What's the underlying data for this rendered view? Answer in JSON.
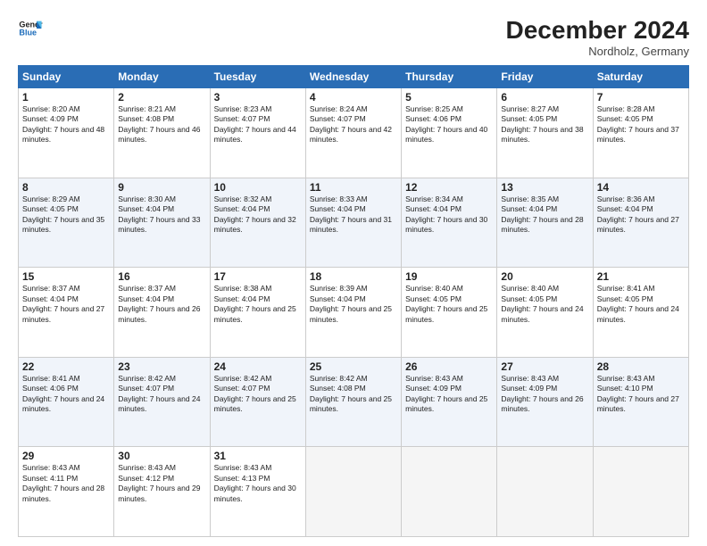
{
  "logo": {
    "line1": "General",
    "line2": "Blue"
  },
  "title": "December 2024",
  "location": "Nordholz, Germany",
  "days_header": [
    "Sunday",
    "Monday",
    "Tuesday",
    "Wednesday",
    "Thursday",
    "Friday",
    "Saturday"
  ],
  "weeks": [
    [
      {
        "day": "1",
        "sunrise": "Sunrise: 8:20 AM",
        "sunset": "Sunset: 4:09 PM",
        "daylight": "Daylight: 7 hours and 48 minutes."
      },
      {
        "day": "2",
        "sunrise": "Sunrise: 8:21 AM",
        "sunset": "Sunset: 4:08 PM",
        "daylight": "Daylight: 7 hours and 46 minutes."
      },
      {
        "day": "3",
        "sunrise": "Sunrise: 8:23 AM",
        "sunset": "Sunset: 4:07 PM",
        "daylight": "Daylight: 7 hours and 44 minutes."
      },
      {
        "day": "4",
        "sunrise": "Sunrise: 8:24 AM",
        "sunset": "Sunset: 4:07 PM",
        "daylight": "Daylight: 7 hours and 42 minutes."
      },
      {
        "day": "5",
        "sunrise": "Sunrise: 8:25 AM",
        "sunset": "Sunset: 4:06 PM",
        "daylight": "Daylight: 7 hours and 40 minutes."
      },
      {
        "day": "6",
        "sunrise": "Sunrise: 8:27 AM",
        "sunset": "Sunset: 4:05 PM",
        "daylight": "Daylight: 7 hours and 38 minutes."
      },
      {
        "day": "7",
        "sunrise": "Sunrise: 8:28 AM",
        "sunset": "Sunset: 4:05 PM",
        "daylight": "Daylight: 7 hours and 37 minutes."
      }
    ],
    [
      {
        "day": "8",
        "sunrise": "Sunrise: 8:29 AM",
        "sunset": "Sunset: 4:05 PM",
        "daylight": "Daylight: 7 hours and 35 minutes."
      },
      {
        "day": "9",
        "sunrise": "Sunrise: 8:30 AM",
        "sunset": "Sunset: 4:04 PM",
        "daylight": "Daylight: 7 hours and 33 minutes."
      },
      {
        "day": "10",
        "sunrise": "Sunrise: 8:32 AM",
        "sunset": "Sunset: 4:04 PM",
        "daylight": "Daylight: 7 hours and 32 minutes."
      },
      {
        "day": "11",
        "sunrise": "Sunrise: 8:33 AM",
        "sunset": "Sunset: 4:04 PM",
        "daylight": "Daylight: 7 hours and 31 minutes."
      },
      {
        "day": "12",
        "sunrise": "Sunrise: 8:34 AM",
        "sunset": "Sunset: 4:04 PM",
        "daylight": "Daylight: 7 hours and 30 minutes."
      },
      {
        "day": "13",
        "sunrise": "Sunrise: 8:35 AM",
        "sunset": "Sunset: 4:04 PM",
        "daylight": "Daylight: 7 hours and 28 minutes."
      },
      {
        "day": "14",
        "sunrise": "Sunrise: 8:36 AM",
        "sunset": "Sunset: 4:04 PM",
        "daylight": "Daylight: 7 hours and 27 minutes."
      }
    ],
    [
      {
        "day": "15",
        "sunrise": "Sunrise: 8:37 AM",
        "sunset": "Sunset: 4:04 PM",
        "daylight": "Daylight: 7 hours and 27 minutes."
      },
      {
        "day": "16",
        "sunrise": "Sunrise: 8:37 AM",
        "sunset": "Sunset: 4:04 PM",
        "daylight": "Daylight: 7 hours and 26 minutes."
      },
      {
        "day": "17",
        "sunrise": "Sunrise: 8:38 AM",
        "sunset": "Sunset: 4:04 PM",
        "daylight": "Daylight: 7 hours and 25 minutes."
      },
      {
        "day": "18",
        "sunrise": "Sunrise: 8:39 AM",
        "sunset": "Sunset: 4:04 PM",
        "daylight": "Daylight: 7 hours and 25 minutes."
      },
      {
        "day": "19",
        "sunrise": "Sunrise: 8:40 AM",
        "sunset": "Sunset: 4:05 PM",
        "daylight": "Daylight: 7 hours and 25 minutes."
      },
      {
        "day": "20",
        "sunrise": "Sunrise: 8:40 AM",
        "sunset": "Sunset: 4:05 PM",
        "daylight": "Daylight: 7 hours and 24 minutes."
      },
      {
        "day": "21",
        "sunrise": "Sunrise: 8:41 AM",
        "sunset": "Sunset: 4:05 PM",
        "daylight": "Daylight: 7 hours and 24 minutes."
      }
    ],
    [
      {
        "day": "22",
        "sunrise": "Sunrise: 8:41 AM",
        "sunset": "Sunset: 4:06 PM",
        "daylight": "Daylight: 7 hours and 24 minutes."
      },
      {
        "day": "23",
        "sunrise": "Sunrise: 8:42 AM",
        "sunset": "Sunset: 4:07 PM",
        "daylight": "Daylight: 7 hours and 24 minutes."
      },
      {
        "day": "24",
        "sunrise": "Sunrise: 8:42 AM",
        "sunset": "Sunset: 4:07 PM",
        "daylight": "Daylight: 7 hours and 25 minutes."
      },
      {
        "day": "25",
        "sunrise": "Sunrise: 8:42 AM",
        "sunset": "Sunset: 4:08 PM",
        "daylight": "Daylight: 7 hours and 25 minutes."
      },
      {
        "day": "26",
        "sunrise": "Sunrise: 8:43 AM",
        "sunset": "Sunset: 4:09 PM",
        "daylight": "Daylight: 7 hours and 25 minutes."
      },
      {
        "day": "27",
        "sunrise": "Sunrise: 8:43 AM",
        "sunset": "Sunset: 4:09 PM",
        "daylight": "Daylight: 7 hours and 26 minutes."
      },
      {
        "day": "28",
        "sunrise": "Sunrise: 8:43 AM",
        "sunset": "Sunset: 4:10 PM",
        "daylight": "Daylight: 7 hours and 27 minutes."
      }
    ],
    [
      {
        "day": "29",
        "sunrise": "Sunrise: 8:43 AM",
        "sunset": "Sunset: 4:11 PM",
        "daylight": "Daylight: 7 hours and 28 minutes."
      },
      {
        "day": "30",
        "sunrise": "Sunrise: 8:43 AM",
        "sunset": "Sunset: 4:12 PM",
        "daylight": "Daylight: 7 hours and 29 minutes."
      },
      {
        "day": "31",
        "sunrise": "Sunrise: 8:43 AM",
        "sunset": "Sunset: 4:13 PM",
        "daylight": "Daylight: 7 hours and 30 minutes."
      },
      null,
      null,
      null,
      null
    ]
  ]
}
